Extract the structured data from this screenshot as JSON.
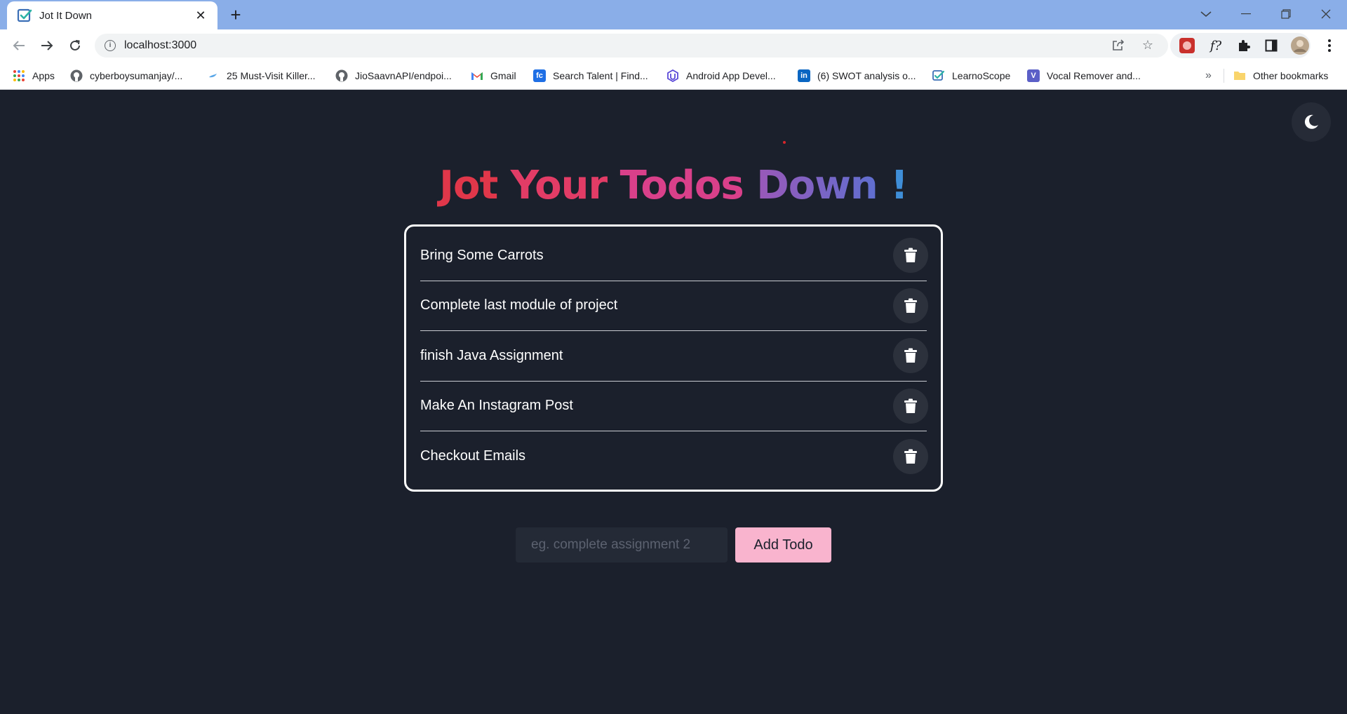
{
  "browser": {
    "tab_title": "Jot It Down",
    "url": "localhost:3000",
    "bookmarks": [
      {
        "label": "Apps",
        "icon": "apps-grid-icon"
      },
      {
        "label": "cyberboysumanjay/...",
        "icon": "github-icon"
      },
      {
        "label": "25 Must-Visit Killer...",
        "icon": "bird-icon"
      },
      {
        "label": "JioSaavnAPI/endpoi...",
        "icon": "github-icon"
      },
      {
        "label": "Gmail",
        "icon": "gmail-icon"
      },
      {
        "label": "Search Talent | Find...",
        "icon": "fc-icon"
      },
      {
        "label": "Android App Devel...",
        "icon": "udacity-icon"
      },
      {
        "label": "(6) SWOT analysis o...",
        "icon": "linkedin-icon"
      },
      {
        "label": "LearnoScope",
        "icon": "checkbox-icon"
      },
      {
        "label": "Vocal Remover and...",
        "icon": "v-icon"
      }
    ],
    "overflow_label": "»",
    "other_bookmarks": "Other bookmarks"
  },
  "page": {
    "heading_words": [
      "Jot",
      "Your",
      "Todos",
      "Down",
      "!"
    ],
    "heading_colors": [
      "#e0374a",
      "#e23c66",
      "#d9408a",
      "#7b63c8",
      "#3f8ed8"
    ],
    "todos": [
      {
        "text": "Bring Some Carrots"
      },
      {
        "text": "Complete last module of project"
      },
      {
        "text": "finish Java Assignment"
      },
      {
        "text": "Make An Instagram Post"
      },
      {
        "text": "Checkout Emails"
      }
    ],
    "input_placeholder": "eg. complete assignment 2",
    "add_button_label": "Add Todo"
  },
  "colors": {
    "background": "#1b202c",
    "accent_button": "#f9b4ce",
    "tabstrip": "#8aaee8"
  }
}
